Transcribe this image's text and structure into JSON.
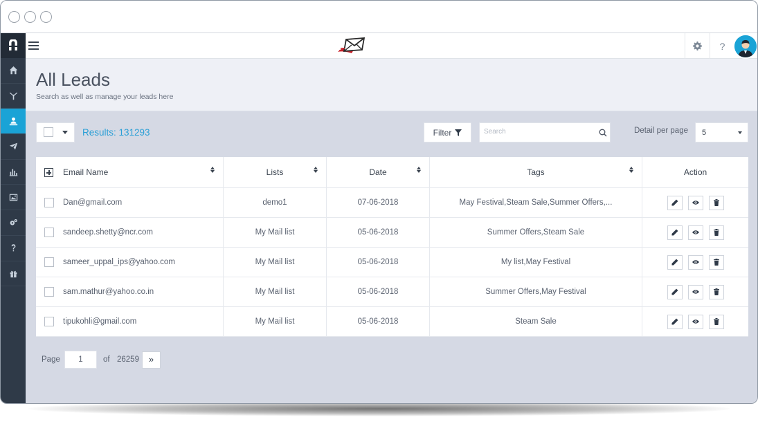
{
  "header": {
    "title": "All Leads",
    "subtitle": "Search as well as manage your leads here"
  },
  "toolbar": {
    "results_text": "Results: 131293",
    "filter_label": "Filter",
    "search_placeholder": "Search",
    "detail_label": "Detail per page",
    "detail_value": "5"
  },
  "table": {
    "columns": [
      "Email Name",
      "Lists",
      "Date",
      "Tags",
      "Action"
    ],
    "rows": [
      {
        "email": "Dan@gmail.com",
        "list": "demo1",
        "date": "07-06-2018",
        "tags": "May Festival,Steam Sale,Summer Offers,..."
      },
      {
        "email": "sandeep.shetty@ncr.com",
        "list": "My Mail list",
        "date": "05-06-2018",
        "tags": "Summer Offers,Steam Sale"
      },
      {
        "email": "sameer_uppal_ips@yahoo.com",
        "list": "My Mail list",
        "date": "05-06-2018",
        "tags": "My list,May Festival"
      },
      {
        "email": "sam.mathur@yahoo.co.in",
        "list": "My Mail list",
        "date": "05-06-2018",
        "tags": "Summer Offers,May Festival"
      },
      {
        "email": "tipukohli@gmail.com",
        "list": "My Mail list",
        "date": "05-06-2018",
        "tags": "Steam Sale"
      }
    ]
  },
  "pagination": {
    "page_label": "Page",
    "current": "1",
    "of_label": "of",
    "total": "26259",
    "next_label": "»"
  },
  "topbar": {
    "help_label": "?"
  },
  "sidebar": {
    "items": [
      "home-icon",
      "antenna-icon",
      "users-icon",
      "paper-plane-icon",
      "bar-chart-icon",
      "image-icon",
      "gears-icon",
      "help-icon",
      "gift-icon"
    ],
    "active_index": 2
  },
  "colors": {
    "accent": "#1aa3d6",
    "sidebar": "#2f3a48",
    "content_bg": "#d5d9e4",
    "header_bg": "#eef0f6"
  }
}
